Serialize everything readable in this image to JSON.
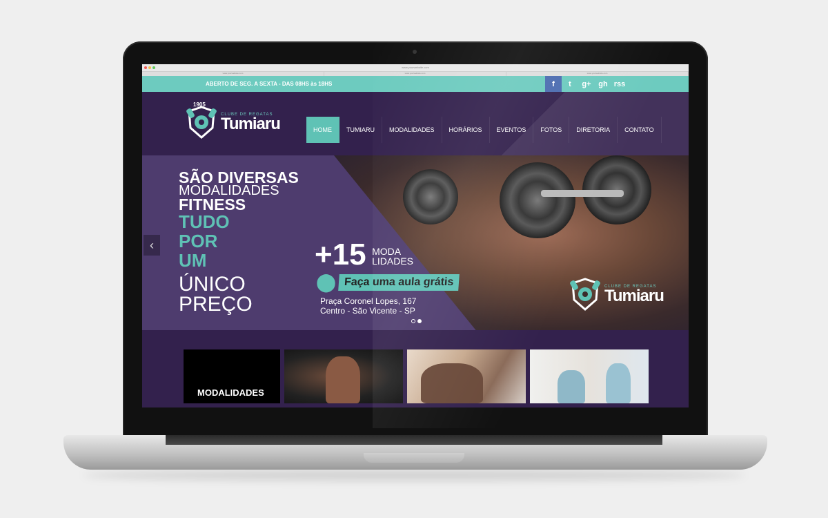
{
  "browser": {
    "url": "www.yourwebsite.com",
    "tabs": [
      "www.yourwebsite.com",
      "www.yourwebsite.com",
      "www.yourwebsite.com"
    ]
  },
  "topbar": {
    "hours": "ABERTO DE SEG. A SEXTA - DAS 08HS às 18HS",
    "social": [
      "f",
      "t",
      "g+",
      "gh",
      "rss"
    ]
  },
  "logo": {
    "year": "1905",
    "subtitle": "CLUBE DE REGATAS",
    "name": "Tumiaru"
  },
  "nav": [
    "HOME",
    "TUMIARU",
    "MODALIDADES",
    "HORÁRIOS",
    "EVENTOS",
    "FOTOS",
    "DIRETORIA",
    "CONTATO"
  ],
  "hero": {
    "line1": "SÃO DIVERSAS",
    "line2": "MODALIDADES",
    "line3": "FITNESS",
    "teal1": "TUDO",
    "teal2": "POR",
    "teal3": "UM",
    "thin1": "ÚNICO",
    "thin2": "PREÇO",
    "promo_num": "+15",
    "promo_mod1": "MODA",
    "promo_mod2": "LIDADES",
    "cta": "Faça uma aula grátis",
    "address1": "Praça Coronel Lopes, 167",
    "address2": "Centro - São Vicente - SP",
    "arrow": "‹"
  },
  "thumbs": {
    "label": "MODALIDADES"
  },
  "colors": {
    "teal": "#5fc2b5",
    "purple": "#33214d",
    "facebook": "#4c6cb0"
  }
}
